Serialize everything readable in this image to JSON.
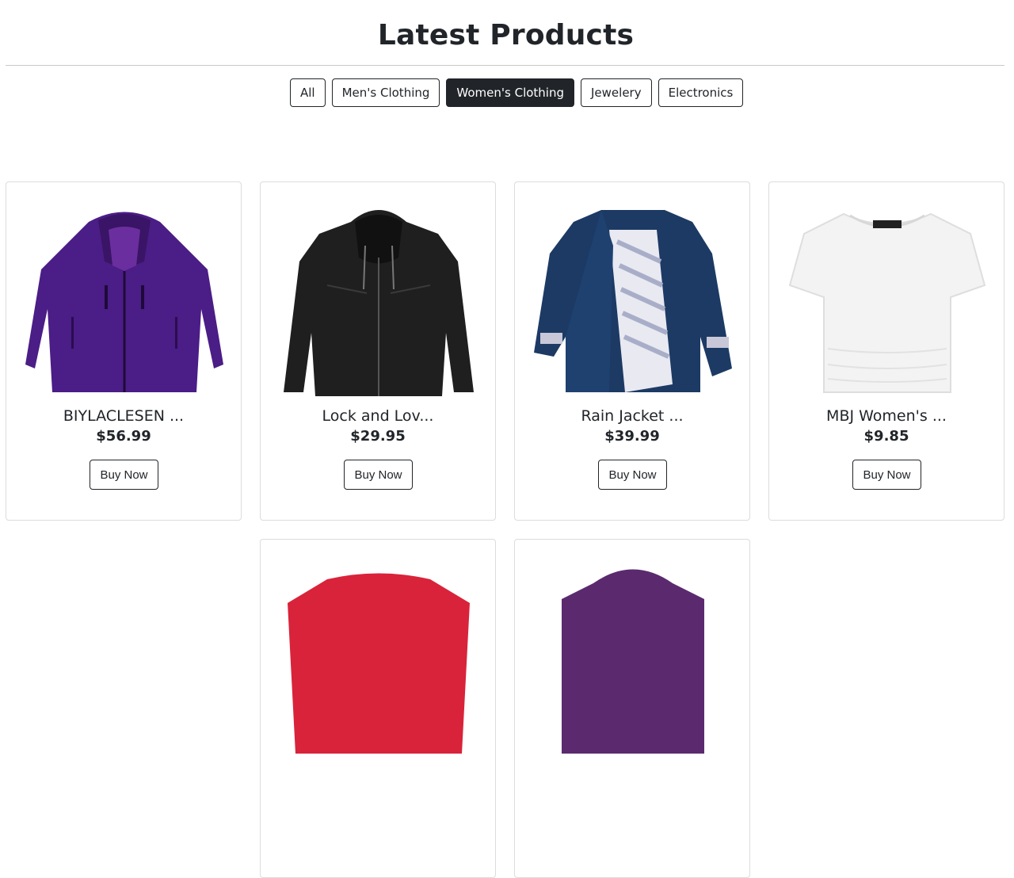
{
  "header": {
    "title": "Latest Products"
  },
  "filters": [
    {
      "label": "All"
    },
    {
      "label": "Men's Clothing"
    },
    {
      "label": "Women's Clothing",
      "active": true
    },
    {
      "label": "Jewelery"
    },
    {
      "label": "Electronics"
    }
  ],
  "products": [
    {
      "title": "BIYLACLESEN ...",
      "price": "$56.99",
      "button": "Buy Now",
      "image": "purple-jacket"
    },
    {
      "title": "Lock and Lov...",
      "price": "$29.95",
      "button": "Buy Now",
      "image": "black-leather-jacket"
    },
    {
      "title": "Rain Jacket ...",
      "price": "$39.99",
      "button": "Buy Now",
      "image": "navy-rain-jacket"
    },
    {
      "title": "MBJ Women's ...",
      "price": "$9.85",
      "button": "Buy Now",
      "image": "white-tshirt"
    },
    {
      "image": "red-top"
    },
    {
      "image": "purple-top"
    }
  ],
  "colors": {
    "primary": "#212529",
    "border": "#dcdcdc"
  }
}
